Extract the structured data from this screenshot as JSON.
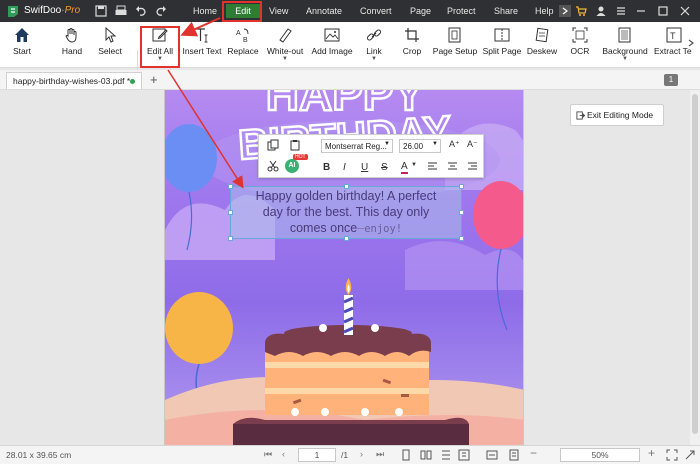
{
  "app": {
    "name": "SwifDoo",
    "edition": "·Pro",
    "menu": [
      "Home",
      "Edit",
      "View",
      "Annotate",
      "Convert",
      "Page",
      "Protect",
      "Share",
      "Help"
    ],
    "active_menu": "Edit"
  },
  "ribbon": {
    "buttons": [
      {
        "label": "Start",
        "icon": "home-icon"
      },
      {
        "label": "Hand",
        "icon": "hand-icon"
      },
      {
        "label": "Select",
        "icon": "cursor-icon"
      },
      {
        "label": "Edit All",
        "icon": "edit-icon"
      },
      {
        "label": "Insert Text",
        "icon": "insert-text-icon"
      },
      {
        "label": "Replace",
        "icon": "replace-icon"
      },
      {
        "label": "White-out",
        "icon": "eraser-icon"
      },
      {
        "label": "Add Image",
        "icon": "image-icon"
      },
      {
        "label": "Link",
        "icon": "link-icon"
      },
      {
        "label": "Crop",
        "icon": "crop-icon"
      },
      {
        "label": "Page Setup",
        "icon": "page-setup-icon"
      },
      {
        "label": "Split Page",
        "icon": "split-page-icon"
      },
      {
        "label": "Deskew",
        "icon": "deskew-icon"
      },
      {
        "label": "OCR",
        "icon": "ocr-icon"
      },
      {
        "label": "Background",
        "icon": "background-icon"
      },
      {
        "label": "Extract Te",
        "icon": "extract-text-icon"
      }
    ]
  },
  "tabs": {
    "document": "happy-birthday-wishes-03.pdf *",
    "page_badge": "1"
  },
  "exit_editing": {
    "label": "Exit Editing Mode"
  },
  "format_toolbar": {
    "font": "Montserrat Reg...",
    "size": "26.00",
    "ai_badge": "AI",
    "hot_badge": "HOT",
    "bold": "B",
    "italic": "I",
    "underline": "U",
    "strike": "S",
    "color": "A",
    "grow": "A⁺",
    "shrink": "A⁻"
  },
  "text_box": {
    "line1": "Happy golden birthday! A perfect",
    "line2": "day for the best. This day only",
    "line3_start": "comes once",
    "line3_end": "enjoy!"
  },
  "page_art": {
    "headline_line1": "HAPPY",
    "headline_line2": "BIRTHDAY"
  },
  "status": {
    "page_size": "28.01 x 39.65 cm",
    "current_page": "1",
    "total_pages": "/1",
    "zoom": "50%"
  },
  "colors": {
    "titlebar": "#2f3033",
    "accent_green": "#2e7d32",
    "highlight_red": "#e0322e",
    "page_purple": "#9f77ee"
  }
}
